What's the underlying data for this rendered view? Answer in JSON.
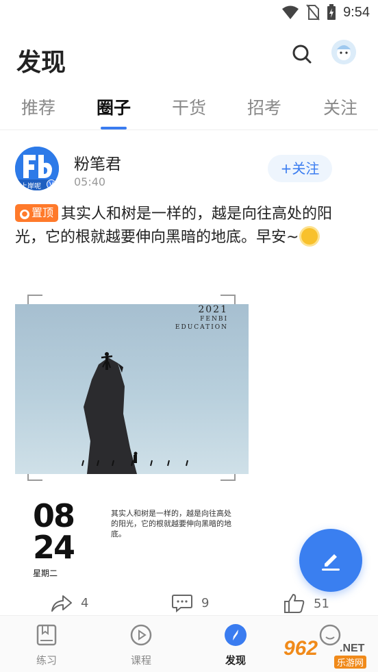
{
  "status_bar": {
    "time": "9:54"
  },
  "header": {
    "title": "发现"
  },
  "tabs": [
    {
      "label": "推荐",
      "active": false
    },
    {
      "label": "圈子",
      "active": true
    },
    {
      "label": "干货",
      "active": false
    },
    {
      "label": "招考",
      "active": false
    },
    {
      "label": "关注",
      "active": false
    }
  ],
  "post": {
    "author": "粉笔君",
    "time": "05:40",
    "follow_label": "+关注",
    "pin_label": "置顶",
    "text": "其实人和树是一样的，越是向往高处的阳光，它的根就越要伸向黑暗的地底。早安~",
    "image": {
      "year": "2021",
      "brand_line1": "FENBI",
      "brand_line2": "EDUCATION",
      "date_line1": "08",
      "date_line2": "24",
      "date_sub": "星期二",
      "quote": "其实人和树是一样的，越是向往高处的阳光，它的根就越要伸向黑暗的地底。"
    },
    "actions": {
      "share_count": "4",
      "comment_count": "9",
      "like_count": "51"
    }
  },
  "avatar_badge": {
    "text": "上岸呢",
    "v": "V"
  },
  "bottom_nav": [
    {
      "label": "练习",
      "active": false
    },
    {
      "label": "课程",
      "active": false
    },
    {
      "label": "发现",
      "active": true
    },
    {
      "label": "",
      "active": false
    }
  ],
  "watermark": {
    "number": "962",
    "net": ".NET",
    "site": "乐游网"
  },
  "colors": {
    "accent": "#3a7cf0",
    "pin": "#ff7a2b",
    "fab": "#3a7ff0"
  }
}
